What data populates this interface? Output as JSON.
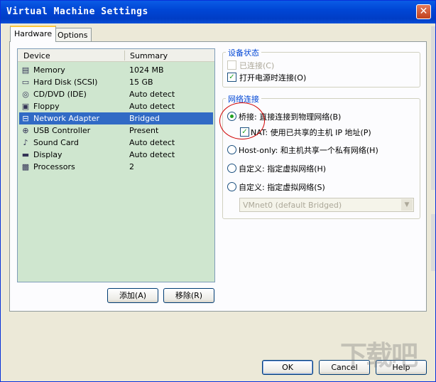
{
  "window": {
    "title": "Virtual Machine Settings",
    "close_glyph": "✕"
  },
  "tabs": [
    {
      "label": "Hardware",
      "active": true
    },
    {
      "label": "Options",
      "active": false
    }
  ],
  "device_list": {
    "columns": [
      "Device",
      "Summary"
    ],
    "rows": [
      {
        "icon": "memory-icon",
        "glyph": "▤",
        "device": "Memory",
        "summary": "1024 MB",
        "selected": false
      },
      {
        "icon": "hard-disk-icon",
        "glyph": "▭",
        "device": "Hard Disk (SCSI)",
        "summary": "15 GB",
        "selected": false
      },
      {
        "icon": "cd-dvd-icon",
        "glyph": "◎",
        "device": "CD/DVD (IDE)",
        "summary": "Auto detect",
        "selected": false
      },
      {
        "icon": "floppy-icon",
        "glyph": "▣",
        "device": "Floppy",
        "summary": "Auto detect",
        "selected": false
      },
      {
        "icon": "network-adapter-icon",
        "glyph": "⊟",
        "device": "Network Adapter",
        "summary": "Bridged",
        "selected": true
      },
      {
        "icon": "usb-controller-icon",
        "glyph": "⊕",
        "device": "USB Controller",
        "summary": "Present",
        "selected": false
      },
      {
        "icon": "sound-card-icon",
        "glyph": "♪",
        "device": "Sound Card",
        "summary": "Auto detect",
        "selected": false
      },
      {
        "icon": "display-icon",
        "glyph": "▬",
        "device": "Display",
        "summary": "Auto detect",
        "selected": false
      },
      {
        "icon": "processor-icon",
        "glyph": "▩",
        "device": "Processors",
        "summary": "2",
        "selected": false
      }
    ]
  },
  "list_buttons": {
    "add": "添加(A)",
    "remove": "移除(R)"
  },
  "device_status": {
    "title": "设备状态",
    "connected": {
      "label": "已连接(C)",
      "checked": false,
      "enabled": false
    },
    "connect_at_power_on": {
      "label": "打开电源时连接(O)",
      "checked": true,
      "enabled": true
    }
  },
  "network": {
    "title": "网络连接",
    "bridged": {
      "label": "桥接: 直接连接到物理网络(B)",
      "selected": true
    },
    "replicate": {
      "label": "NAT: 使用已共享的主机 IP 地址(P)",
      "checked": true
    },
    "host_only": {
      "label": "Host-only: 和主机共享一个私有网络(H)",
      "selected": false
    },
    "custom_1": {
      "label": "自定义: 指定虚拟网络(H)",
      "selected": false
    },
    "custom_2": {
      "label": "自定义: 指定虚拟网络(S)",
      "selected": false
    },
    "vmnet": {
      "value": "VMnet0 (default Bridged)",
      "enabled": false
    }
  },
  "footer": {
    "ok": "OK",
    "cancel": "Cancel",
    "help": "Help"
  },
  "watermark": "下载吧",
  "colors": {
    "title_bar": "#0046d5",
    "list_bg": "#cfe6cf",
    "selection": "#316ac5",
    "annotation": "#d00000"
  }
}
